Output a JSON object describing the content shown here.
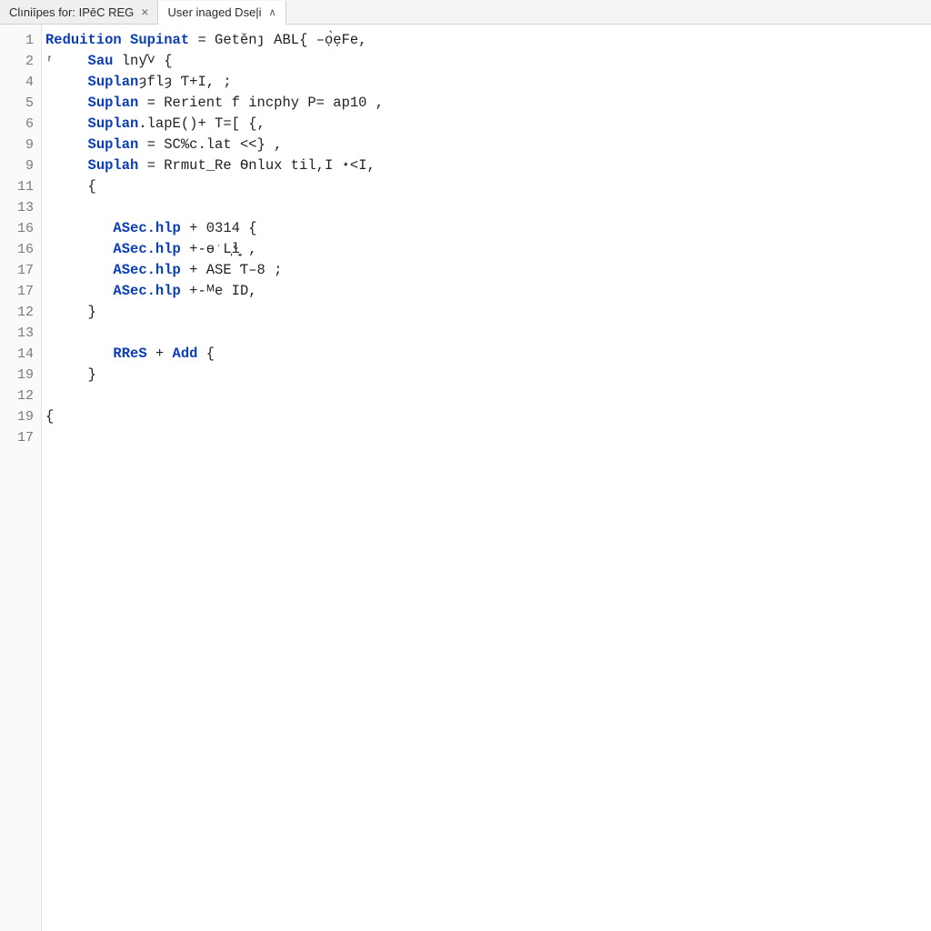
{
  "tabs": [
    {
      "label": "Clıniīpes for: IPēC REG",
      "closable": true,
      "active": false
    },
    {
      "label": "User inaged Dse|i",
      "closable": false,
      "active": true
    }
  ],
  "gutter_lines": [
    "1",
    "2",
    "4",
    "5",
    "6",
    "9",
    "9",
    "11",
    "13",
    "16",
    "16",
    "17",
    "17",
    "12",
    "13",
    "14",
    "19",
    "12",
    "19",
    "17"
  ],
  "code_lines": [
    {
      "segments": [
        {
          "cls": "kw",
          "t": "Reduition Supinat"
        },
        {
          "cls": "pl",
          "t": " = Ԍetěnȷ ABL{ –ọ̀ẹFe,"
        }
      ]
    },
    {
      "segments": [
        {
          "cls": "pl",
          "t": "ʳ    "
        },
        {
          "cls": "kw",
          "t": "Sau"
        },
        {
          "cls": "pl",
          "t": " lnƴ˅ {"
        }
      ]
    },
    {
      "segments": [
        {
          "cls": "pl",
          "t": "     "
        },
        {
          "cls": "kw",
          "t": "Suplan"
        },
        {
          "cls": "pl",
          "t": "ȝflȝ Ƭ+I, ;"
        }
      ]
    },
    {
      "segments": [
        {
          "cls": "pl",
          "t": "     "
        },
        {
          "cls": "kw",
          "t": "Suplan"
        },
        {
          "cls": "pl",
          "t": " = Rerient f incphy P= ap10 ,"
        }
      ]
    },
    {
      "segments": [
        {
          "cls": "pl",
          "t": "     "
        },
        {
          "cls": "kw",
          "t": "Suplan"
        },
        {
          "cls": "pl",
          "t": ".lapE()+ T=[ {,"
        }
      ]
    },
    {
      "segments": [
        {
          "cls": "pl",
          "t": "     "
        },
        {
          "cls": "kw",
          "t": "Suplan"
        },
        {
          "cls": "pl",
          "t": " = SC%c.lat <˂} ,"
        }
      ]
    },
    {
      "segments": [
        {
          "cls": "pl",
          "t": "     "
        },
        {
          "cls": "kw",
          "t": "Suplah"
        },
        {
          "cls": "pl",
          "t": " = Rrmut_Re Ѳnlux til,I ⋆<I,"
        }
      ]
    },
    {
      "segments": [
        {
          "cls": "pl",
          "t": "     {"
        }
      ]
    },
    {
      "segments": [
        {
          "cls": "pl",
          "t": " "
        }
      ]
    },
    {
      "segments": [
        {
          "cls": "pl",
          "t": "        "
        },
        {
          "cls": "id",
          "t": "ASec.hlp"
        },
        {
          "cls": "pl",
          "t": " + 0314 {"
        }
      ]
    },
    {
      "segments": [
        {
          "cls": "pl",
          "t": "        "
        },
        {
          "cls": "id",
          "t": "ASec.hlp"
        },
        {
          "cls": "pl",
          "t": " +-ɵˑL̩ɬ̩̬ ,"
        }
      ]
    },
    {
      "segments": [
        {
          "cls": "pl",
          "t": "        "
        },
        {
          "cls": "id",
          "t": "ASec.hlp"
        },
        {
          "cls": "pl",
          "t": " + ASE Ƭ–8 ;"
        }
      ]
    },
    {
      "segments": [
        {
          "cls": "pl",
          "t": "        "
        },
        {
          "cls": "id",
          "t": "ASec.hlp"
        },
        {
          "cls": "pl",
          "t": " +-ᴹe ID,"
        }
      ]
    },
    {
      "segments": [
        {
          "cls": "pl",
          "t": "     }"
        }
      ]
    },
    {
      "segments": [
        {
          "cls": "pl",
          "t": " "
        }
      ]
    },
    {
      "segments": [
        {
          "cls": "pl",
          "t": "        "
        },
        {
          "cls": "fn",
          "t": "RReS"
        },
        {
          "cls": "pl",
          "t": " + "
        },
        {
          "cls": "fn",
          "t": "Add"
        },
        {
          "cls": "pl",
          "t": " {"
        }
      ]
    },
    {
      "segments": [
        {
          "cls": "pl",
          "t": "     }"
        }
      ]
    },
    {
      "segments": [
        {
          "cls": "pl",
          "t": " "
        }
      ]
    },
    {
      "segments": [
        {
          "cls": "pl",
          "t": "{"
        }
      ]
    },
    {
      "segments": [
        {
          "cls": "pl",
          "t": " "
        }
      ]
    }
  ]
}
